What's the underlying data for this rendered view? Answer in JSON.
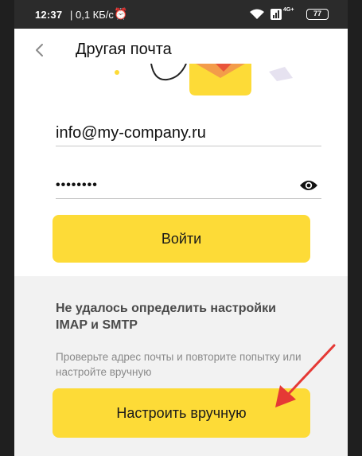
{
  "status_bar": {
    "time": "12:37",
    "network_speed": "| 0,1 КБ/с",
    "lte_label": "4G+",
    "battery": "77"
  },
  "header": {
    "back_icon": "chevron-left-icon",
    "title": "Другая почта"
  },
  "form": {
    "email_value": "info@my-company.ru",
    "password_masked": "••••••••",
    "show_password_icon": "eye-icon",
    "login_button": "Войти"
  },
  "error": {
    "title": "Не удалось определить настройки IMAP и SMTP",
    "hint": "Проверьте адрес почты и повторите попытку или настройте вручную",
    "manual_button": "Настроить вручную"
  },
  "colors": {
    "accent_yellow": "#fddb37",
    "annotation_red": "#e53935",
    "status_bar": "#2b2b2b",
    "panel_gray": "#f2f2f2"
  }
}
